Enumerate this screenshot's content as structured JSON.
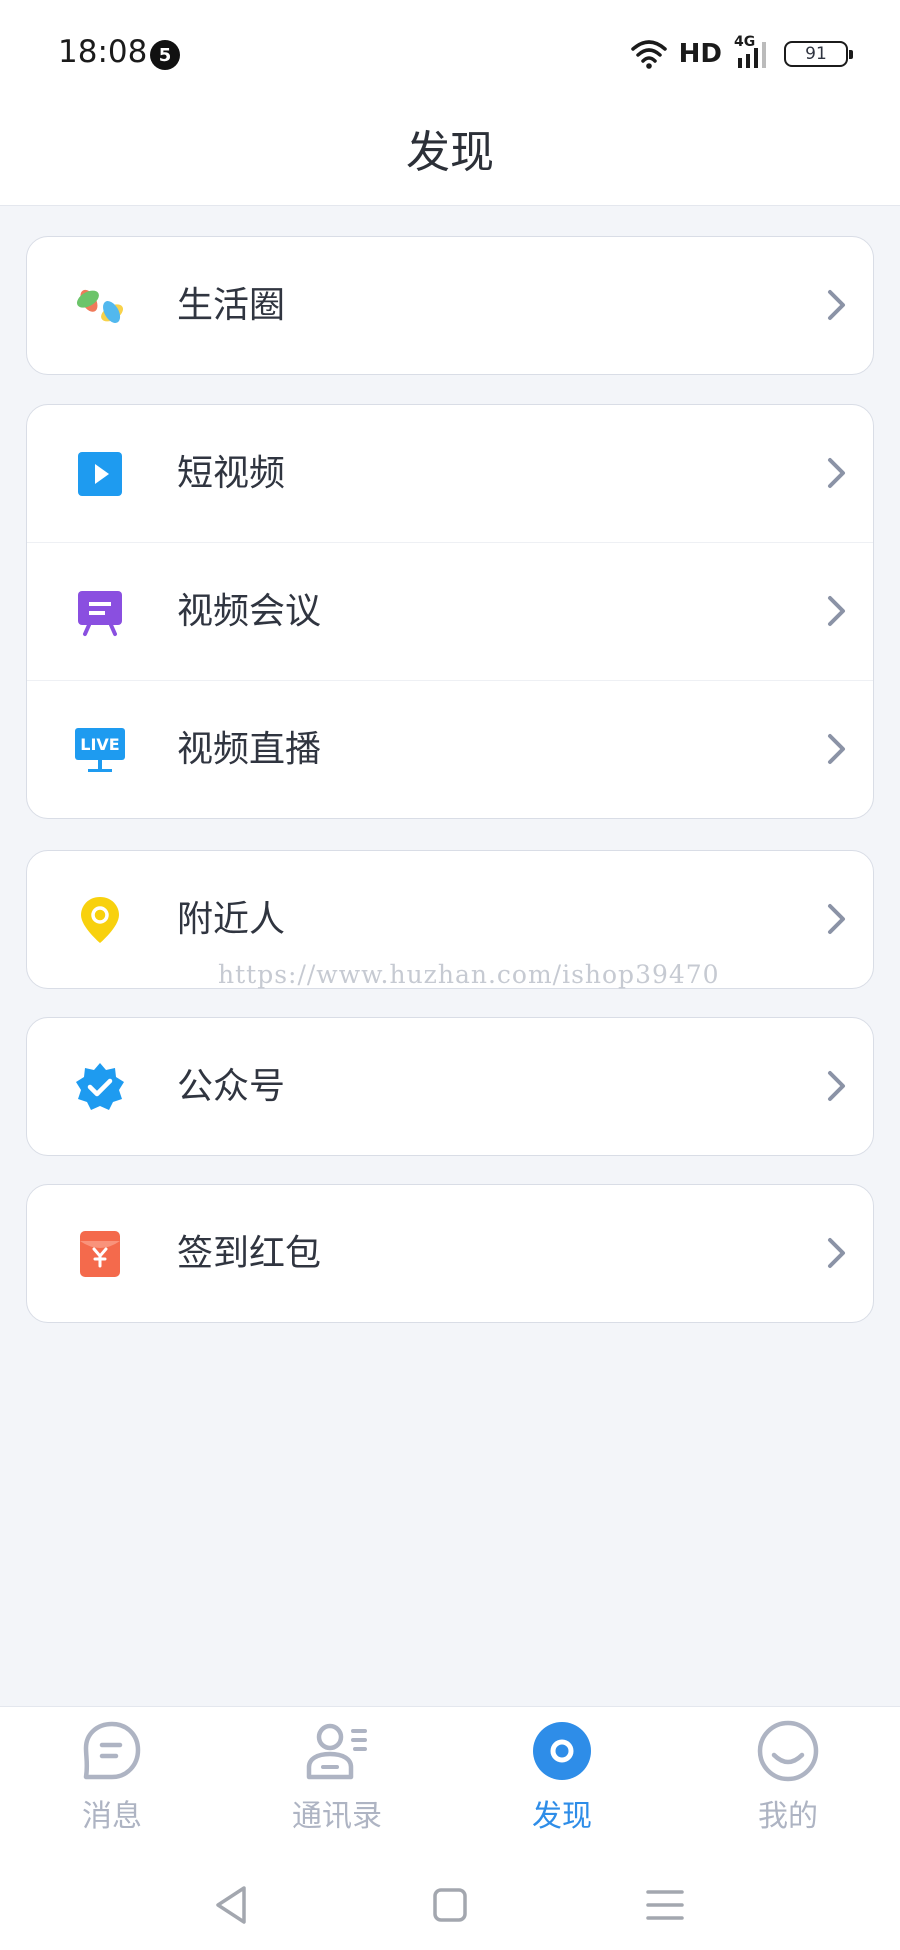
{
  "status_bar": {
    "time": "18:08",
    "notification_count": "5",
    "network_label": "HD",
    "signal_label": "4G",
    "battery": "91"
  },
  "header": {
    "title": "发现"
  },
  "menu": {
    "moments": {
      "label": "生活圈",
      "icon": "pinwheel-icon"
    },
    "short_video": {
      "label": "短视频",
      "icon": "play-icon"
    },
    "video_meeting": {
      "label": "视频会议",
      "icon": "meeting-board-icon"
    },
    "live": {
      "label": "视频直播",
      "icon": "live-screen-icon",
      "badge": "LIVE"
    },
    "nearby": {
      "label": "附近人",
      "icon": "location-pin-icon"
    },
    "official_accounts": {
      "label": "公众号",
      "icon": "verified-badge-icon"
    },
    "checkin": {
      "label": "签到红包",
      "icon": "red-envelope-icon"
    }
  },
  "watermark": "https://www.huzhan.com/ishop39470",
  "tabbar": {
    "messages": "消息",
    "contacts": "通讯录",
    "discover": "发现",
    "me": "我的",
    "active": "discover"
  },
  "colors": {
    "accent": "#2e8de8",
    "tab_inactive": "#aeb4c3",
    "background": "#f3f5f9",
    "short_video": "#1e9bf0",
    "meeting": "#8a4fe0",
    "live": "#1e9bf0",
    "nearby": "#f8d10e",
    "official": "#1e9bf0",
    "checkin": "#f46a4c"
  }
}
